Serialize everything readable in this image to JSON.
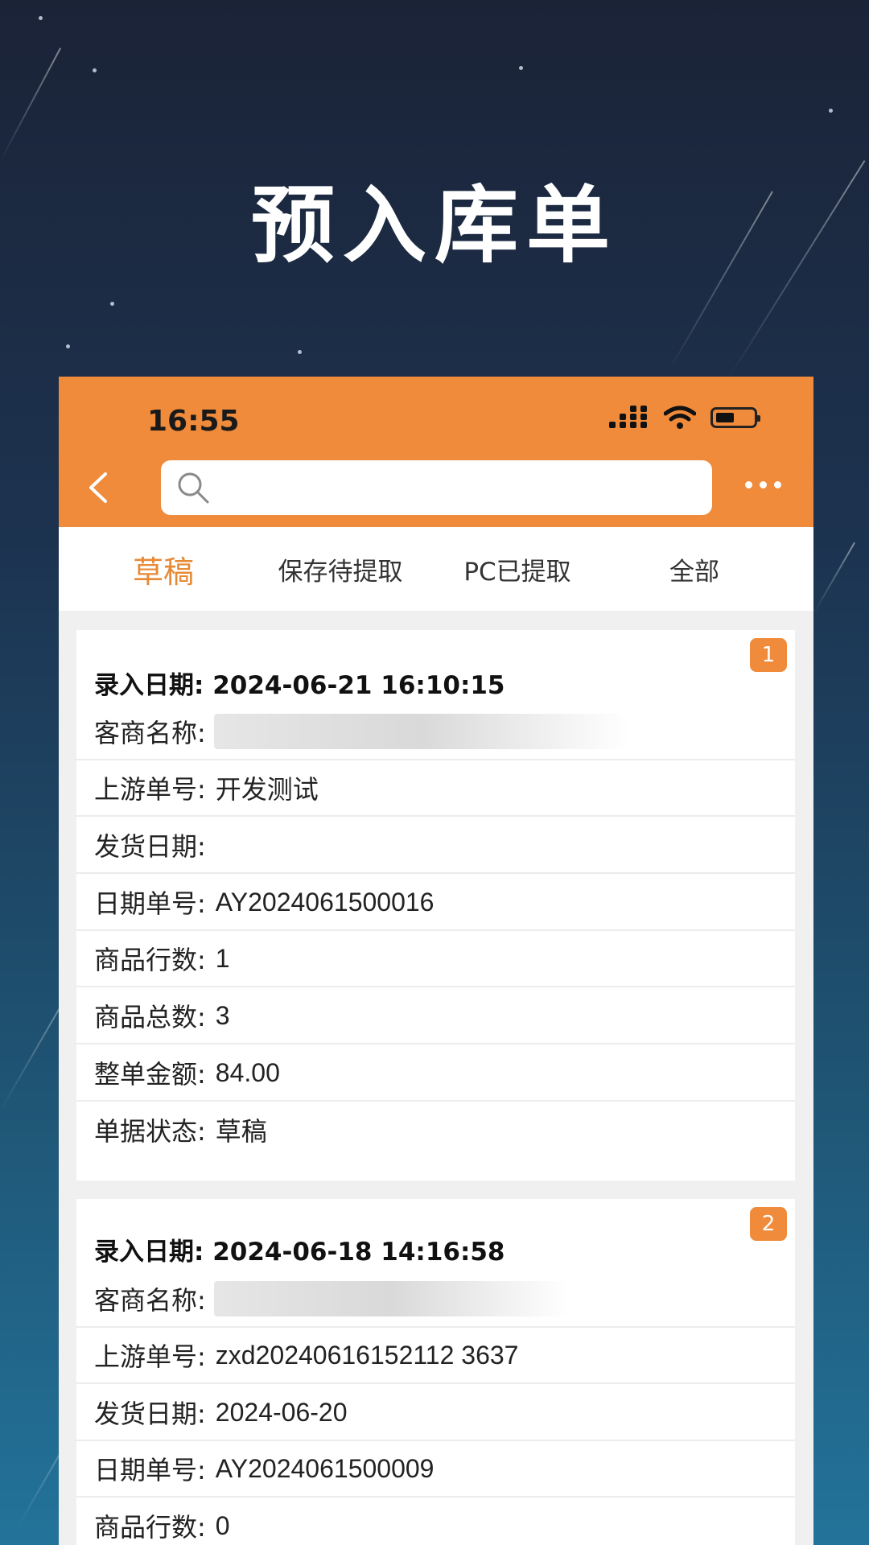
{
  "hero": {
    "title": "预入库单"
  },
  "status_bar": {
    "time": "16:55"
  },
  "header": {
    "search": {
      "placeholder": "",
      "value": ""
    }
  },
  "tabs": [
    {
      "label": "草稿",
      "active": true
    },
    {
      "label": "保存待提取",
      "active": false
    },
    {
      "label": "PC已提取",
      "active": false
    },
    {
      "label": "全部",
      "active": false
    }
  ],
  "colors": {
    "accent": "#ef8b3b",
    "active_tab": "#e78a36"
  },
  "orders": [
    {
      "index": "1",
      "entry_date_label": "录入日期:",
      "entry_date": "2024-06-21 16:10:15",
      "fields": [
        {
          "label": "客商名称:",
          "value": ""
        },
        {
          "label": "上游单号:",
          "value": "开发测试"
        },
        {
          "label": "发货日期:",
          "value": ""
        },
        {
          "label": "日期单号:",
          "value": "AY2024061500016"
        },
        {
          "label": "商品行数:",
          "value": "1"
        },
        {
          "label": "商品总数:",
          "value": "3"
        },
        {
          "label": "整单金额:",
          "value": "84.00"
        },
        {
          "label": "单据状态:",
          "value": "草稿"
        }
      ]
    },
    {
      "index": "2",
      "entry_date_label": "录入日期:",
      "entry_date": "2024-06-18 14:16:58",
      "fields": [
        {
          "label": "客商名称:",
          "value": ""
        },
        {
          "label": "上游单号:",
          "value": "zxd20240616152112 3637"
        },
        {
          "label": "发货日期:",
          "value": "2024-06-20"
        },
        {
          "label": "日期单号:",
          "value": "AY2024061500009"
        },
        {
          "label": "商品行数:",
          "value": "0"
        }
      ]
    }
  ]
}
